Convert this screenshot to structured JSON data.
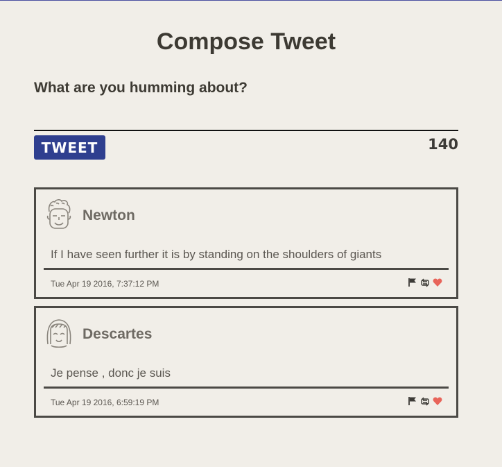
{
  "header": {
    "title": "Compose Tweet"
  },
  "compose": {
    "label": "What are you humming about?",
    "value": "",
    "button_label": "TWEET",
    "counter": "140"
  },
  "tweets": [
    {
      "author": "Newton",
      "text": "If I have seen further it is by standing on the shoulders of giants",
      "timestamp": "Tue Apr 19 2016, 7:37:12 PM",
      "avatar_icon": "curly-hair-avatar-icon",
      "actions": [
        "flag-icon",
        "retweet-icon",
        "heart-icon"
      ]
    },
    {
      "author": "Descartes",
      "text": "Je pense , donc je suis",
      "timestamp": "Tue Apr 19 2016, 6:59:19 PM",
      "avatar_icon": "bob-hair-avatar-icon",
      "actions": [
        "flag-icon",
        "retweet-icon",
        "heart-icon"
      ]
    }
  ],
  "colors": {
    "background": "#f1eee8",
    "accent": "#2f3f8f",
    "heart": "#e8645a",
    "card_border": "#4b4945"
  }
}
